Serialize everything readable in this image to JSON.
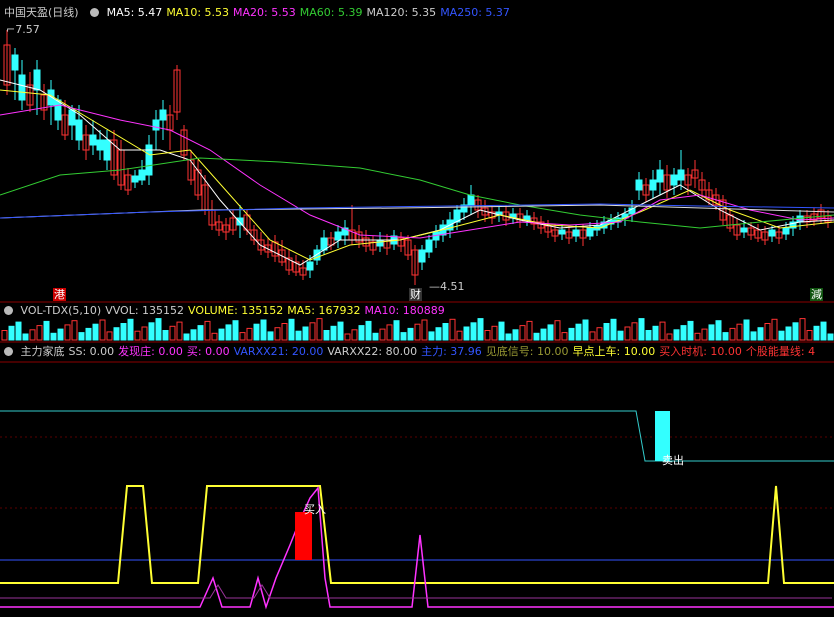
{
  "price_panel": {
    "title": "中国天盈(日线)",
    "ma": [
      {
        "label": "MA5: 5.47",
        "color": "#ffffff"
      },
      {
        "label": "MA10: 5.53",
        "color": "#ffff33"
      },
      {
        "label": "MA20: 5.53",
        "color": "#ff33ff"
      },
      {
        "label": "MA60: 5.39",
        "color": "#33cc33"
      },
      {
        "label": "MA120: 5.35",
        "color": "#cccccc"
      },
      {
        "label": "MA250: 5.37",
        "color": "#3355ff"
      }
    ],
    "high_label": "7.57",
    "low_label": "4.51",
    "markers": {
      "gang": "港",
      "cai": "财",
      "jian": "減"
    }
  },
  "volume_panel": {
    "items": [
      {
        "label": "VOL-TDX(5,10)",
        "color": "#cccccc"
      },
      {
        "label": "VVOL: 135152",
        "color": "#cccccc"
      },
      {
        "label": "VOLUME: 135152",
        "color": "#ffff33"
      },
      {
        "label": "MA5: 167932",
        "color": "#ffff33"
      },
      {
        "label": "MA10: 180889",
        "color": "#ff33ff"
      }
    ]
  },
  "indicator_panel": {
    "items": [
      {
        "label": "主力家底",
        "color": "#cccccc"
      },
      {
        "label": "SS: 0.00",
        "color": "#cccccc"
      },
      {
        "label": "发现庄: 0.00",
        "color": "#ff33ff"
      },
      {
        "label": "买: 0.00",
        "color": "#ff33ff"
      },
      {
        "label": "VARXX21: 20.00",
        "color": "#3355ff"
      },
      {
        "label": "VARXX22: 80.00",
        "color": "#cccccc"
      },
      {
        "label": "主力: 37.96",
        "color": "#3355ff"
      },
      {
        "label": "见底信号: 10.00",
        "color": "#999933"
      },
      {
        "label": "早点上车: 10.00",
        "color": "#ffff33"
      },
      {
        "label": "买入时机: 10.00",
        "color": "#ff3333"
      },
      {
        "label": "个股能量线: 4",
        "color": "#ff3333"
      }
    ],
    "buy_label": "买入",
    "sell_label": "卖出"
  }
}
